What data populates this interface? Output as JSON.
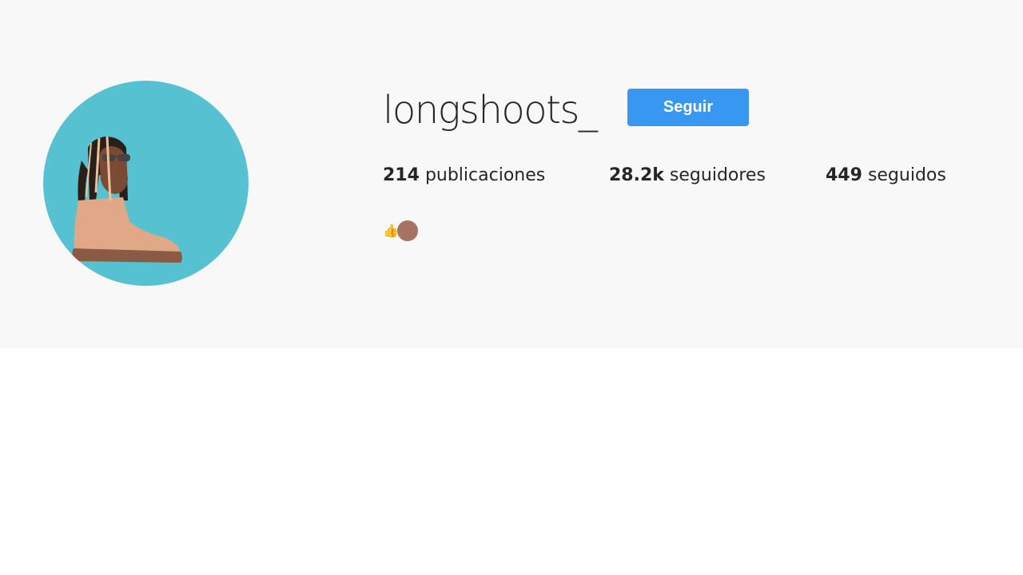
{
  "profile": {
    "username": "longshoots_",
    "follow_button_label": "Seguir",
    "avatar_icon": "avatar-illustration-icon",
    "stats": {
      "posts_count": "214",
      "posts_label": "publicaciones",
      "followers_count": "28.2k",
      "followers_label": "seguidores",
      "following_count": "449",
      "following_label": "seguidos"
    },
    "bio": {
      "emoji_icons": [
        "thumbs-up-icon",
        "brown-circle-icon"
      ]
    }
  },
  "colors": {
    "header_background": "#f8f8f8",
    "follow_button": "#3897f0",
    "avatar_background": "#56c2d1",
    "text": "#262626"
  }
}
